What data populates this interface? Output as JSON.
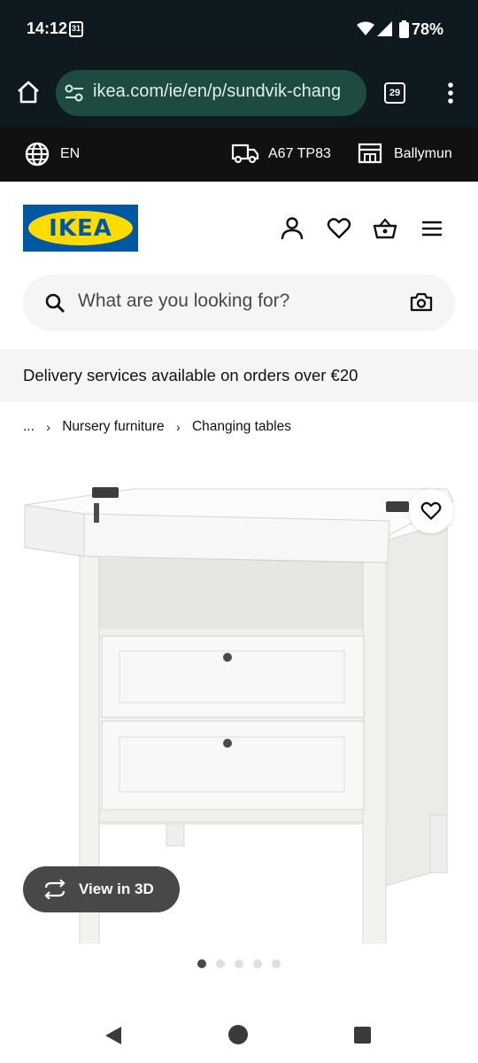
{
  "status": {
    "time": "14:12",
    "calendar_day": "31",
    "battery": "78%"
  },
  "browser": {
    "url": "ikea.com/ie/en/p/sundvik-chang",
    "tab_count": "29"
  },
  "store_bar": {
    "language": "EN",
    "postcode": "A67 TP83",
    "store": "Ballymun"
  },
  "header": {
    "logo_text": "IKEA"
  },
  "search": {
    "placeholder": "What are you looking for?"
  },
  "banner": {
    "text": "Delivery services available on orders over €20"
  },
  "breadcrumb": {
    "ellipsis": "...",
    "items": [
      "Nursery furniture",
      "Changing tables"
    ],
    "separator": "›"
  },
  "product": {
    "view3d_label": "View in 3D",
    "image_count": 5,
    "active_image_index": 0
  },
  "colors": {
    "status_bg": "#0f1a20",
    "url_field_bg": "#1d4b3f",
    "store_bar_bg": "#111111",
    "ikea_blue": "#0058a3",
    "ikea_yellow": "#ffdb00",
    "banner_bg": "#f5f5f5",
    "view3d_bg": "#484848"
  },
  "icons": {
    "status": [
      "calendar-icon",
      "wifi-icon",
      "signal-icon",
      "battery-icon"
    ],
    "browser": [
      "home-icon",
      "tune-icon",
      "tabs-icon",
      "more-vert-icon"
    ],
    "store_bar": [
      "globe-icon",
      "truck-icon",
      "store-icon"
    ],
    "header": [
      "user-icon",
      "heart-icon",
      "basket-icon",
      "menu-icon"
    ],
    "search": [
      "search-icon",
      "camera-icon"
    ],
    "product": [
      "heart-icon",
      "rotate-3d-icon"
    ],
    "nav": [
      "back-icon",
      "home-icon",
      "recents-icon"
    ]
  }
}
